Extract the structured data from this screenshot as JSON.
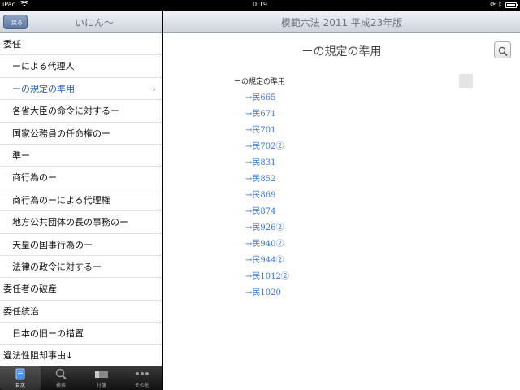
{
  "status_bar": {
    "carrier": "iPad",
    "time": "0:19"
  },
  "left_pane": {
    "back_label": "戻る",
    "title": "いにん〜",
    "items": [
      {
        "label": "委任",
        "selected": false
      },
      {
        "label": "　ーによる代理人",
        "selected": false
      },
      {
        "label": "　ーの規定の準用",
        "selected": true
      },
      {
        "label": "　各省大臣の命令に対するー",
        "selected": false
      },
      {
        "label": "　国家公務員の任命権のー",
        "selected": false
      },
      {
        "label": "　準ー",
        "selected": false
      },
      {
        "label": "　商行為のー",
        "selected": false
      },
      {
        "label": "　商行為のーによる代理権",
        "selected": false
      },
      {
        "label": "　地方公共団体の長の事務のー",
        "selected": false
      },
      {
        "label": "　天皇の国事行為のー",
        "selected": false
      },
      {
        "label": "　法律の政令に対するー",
        "selected": false
      },
      {
        "label": "委任者の破産",
        "selected": false
      },
      {
        "label": "委任統治",
        "selected": false
      },
      {
        "label": "　日本の旧ーの措置",
        "selected": false
      },
      {
        "label": "違法性阻却事由↓",
        "selected": false
      }
    ],
    "chevron": "›"
  },
  "tab_bar": {
    "tabs": [
      {
        "label": "目次",
        "icon": "book-icon",
        "active": true
      },
      {
        "label": "検索",
        "icon": "magnifier-icon",
        "active": false
      },
      {
        "label": "付箋",
        "icon": "bookmark-icon",
        "active": false
      },
      {
        "label": "その他",
        "icon": "more-icon",
        "active": false
      }
    ]
  },
  "right_pane": {
    "book_title": "模範六法 2011 平成23年版",
    "page_title": "ーの規定の準用",
    "content_heading": "ーの規定の準用",
    "references": [
      "→民665",
      "→民671",
      "→民701",
      "→民702②",
      "→民831",
      "→民852",
      "→民869",
      "→民874",
      "→民926②",
      "→民940②",
      "→民944②",
      "→民1012②",
      "→民1020"
    ]
  },
  "colors": {
    "link": "#3b73d4",
    "selected": "#2d5aa8",
    "header_text": "#6e7480"
  }
}
